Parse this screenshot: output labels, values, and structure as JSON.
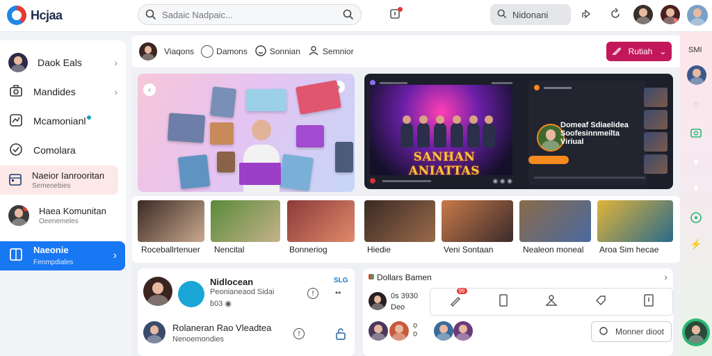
{
  "header": {
    "brand": "Hcjaa",
    "search_placeholder": "Sadaic Nadpaic...",
    "search2_label": "Nidonani"
  },
  "sidebar": {
    "items": [
      {
        "label": "Daok Eals"
      },
      {
        "label": "Mandides"
      },
      {
        "label": "Mcamonianl"
      },
      {
        "label": "Comolara"
      },
      {
        "label": "Naeior Ianrooritan",
        "sub": "Semenebies"
      },
      {
        "label": "Haea Komunitan",
        "sub": "Oeenemeles"
      }
    ],
    "active": {
      "label": "Naeonie",
      "sub": "Fenmpdiales"
    }
  },
  "filters": {
    "items": [
      "Viaqons",
      "Damons",
      "Sonnian",
      "Semnior"
    ],
    "primary_button": "Rutiah"
  },
  "hero_right": {
    "stage_title": "SANHAN ANIATTAS",
    "live_text": "Domeaf Sdiaelidea Soofesinnmeilta Viriual"
  },
  "photos": {
    "captions": [
      "Roceballrtenuer",
      "Nencital",
      "Bonneriog",
      "Hiedie",
      "Veni Sontaan",
      "Nealeon moneal",
      "Aroa Sim hecae"
    ]
  },
  "bottom_left": {
    "title": "Nidlocean",
    "line1": "Peonianeaod  Sidai",
    "line2": "ɓ03 ◉",
    "tag": "SLG",
    "row2_title": "Rolaneran Rao Vleadtea",
    "row2_sub": "Nenoemondies"
  },
  "bottom_right": {
    "header": "Dollars Bamen",
    "meta1": "0s 3930",
    "meta2": "Deo",
    "notif": "99",
    "button": "Monner dioot"
  },
  "right_rail": {
    "label": "SMI"
  }
}
